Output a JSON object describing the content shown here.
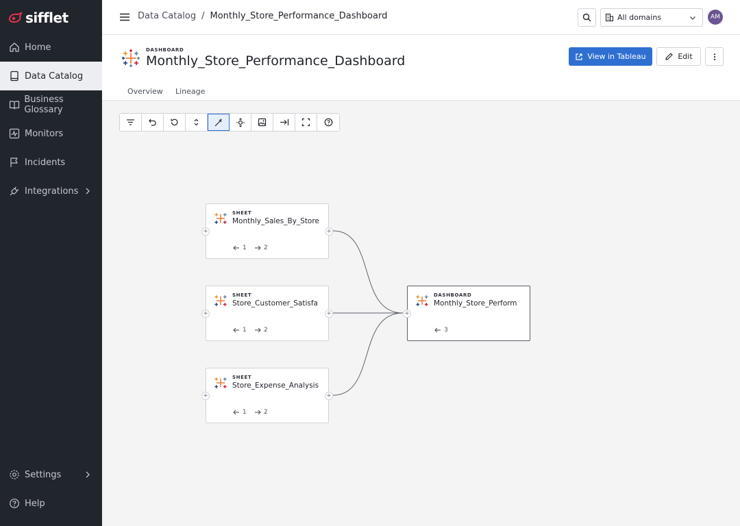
{
  "brand": {
    "name": "sifflet"
  },
  "sidebar": {
    "items": [
      {
        "label": "Home",
        "icon": "home-icon"
      },
      {
        "label": "Data Catalog",
        "icon": "book-icon",
        "active": true
      },
      {
        "label": "Business Glossary",
        "icon": "open-book-icon"
      },
      {
        "label": "Monitors",
        "icon": "monitor-icon"
      },
      {
        "label": "Incidents",
        "icon": "flag-icon"
      },
      {
        "label": "Integrations",
        "icon": "plug-icon"
      }
    ],
    "bottom": [
      {
        "label": "Settings",
        "icon": "gear-icon"
      },
      {
        "label": "Help",
        "icon": "help-icon"
      }
    ]
  },
  "header": {
    "breadcrumb": {
      "parent": "Data Catalog",
      "separator": "/",
      "current": "Monthly_Store_Performance_Dashboard"
    },
    "domain_select": "All domains",
    "avatar_initials": "AM"
  },
  "asset": {
    "type": "DASHBOARD",
    "title": "Monthly_Store_Performance_Dashboard",
    "view_button": "View in Tableau",
    "edit_button": "Edit",
    "tabs": [
      "Overview",
      "Lineage"
    ]
  },
  "lineage": {
    "nodes": [
      {
        "type": "SHEET",
        "name": "Monthly_Sales_By_Store",
        "upstream": "1",
        "downstream": "2"
      },
      {
        "type": "SHEET",
        "name": "Store_Customer_Satisfa",
        "upstream": "1",
        "downstream": "2"
      },
      {
        "type": "SHEET",
        "name": "Store_Expense_Analysis",
        "upstream": "1",
        "downstream": "2"
      },
      {
        "type": "DASHBOARD",
        "name": "Monthly_Store_Perform",
        "upstream": "3"
      }
    ]
  },
  "colors": {
    "sidebar_bg": "#21252c",
    "primary": "#2f6fd1",
    "brand_red": "#e8334a",
    "avatar": "#6b5591"
  }
}
